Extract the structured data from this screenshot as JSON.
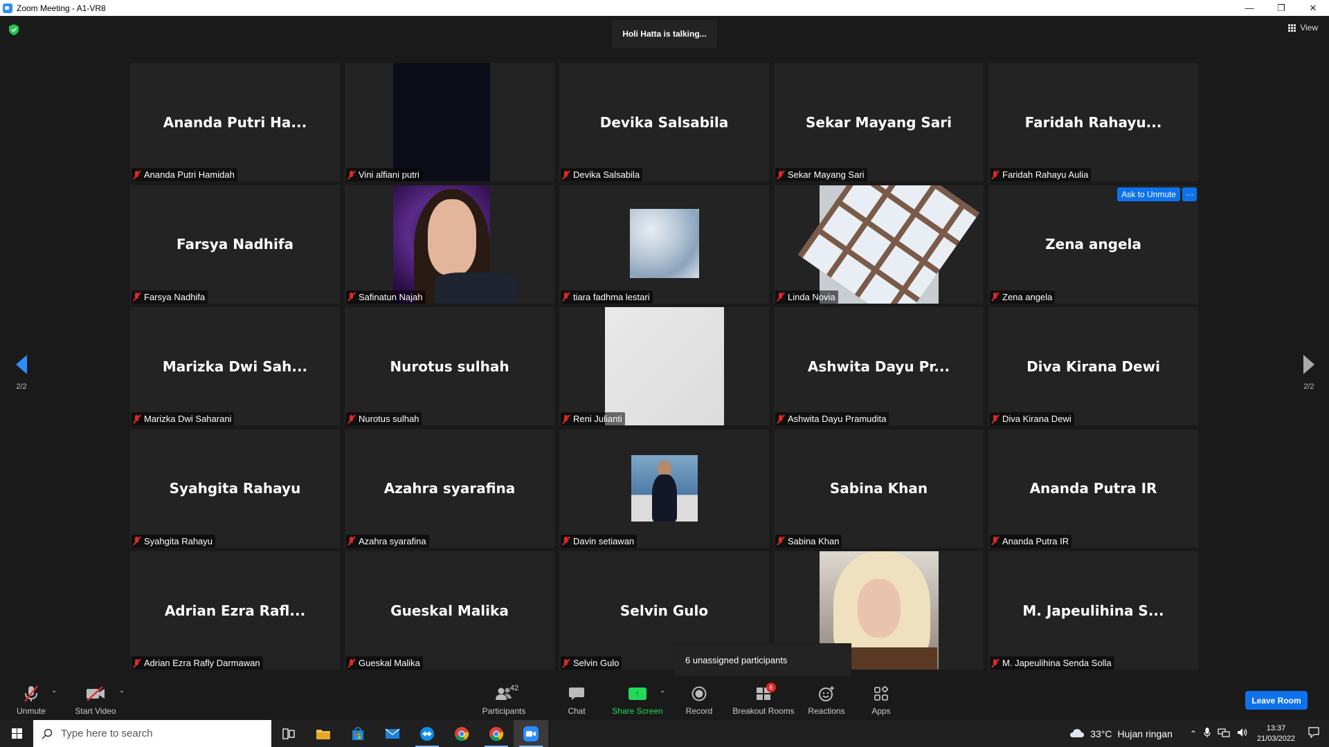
{
  "window": {
    "title": "Zoom Meeting - A1-VR8",
    "controls": [
      "—",
      "❐",
      "✕"
    ]
  },
  "meeting": {
    "talking_text": "Holi Hatta is talking...",
    "view_label": "View",
    "page_prev": "2/2",
    "page_next": "2/2",
    "unassigned_text": "6 unassigned participants",
    "ask_to_unmute": "Ask to Unmute",
    "more": "···"
  },
  "tiles": [
    {
      "big": "Ananda Putri Ha...",
      "name": "Ananda Putri Hamidah"
    },
    {
      "big": "",
      "name": "Vini alfiani putri",
      "video": "dark"
    },
    {
      "big": "Devika Salsabila",
      "name": "Devika Salsabila"
    },
    {
      "big": "Sekar Mayang Sari",
      "name": "Sekar Mayang Sari"
    },
    {
      "big": "Faridah  Rahayu...",
      "name": "Faridah Rahayu Aulia"
    },
    {
      "big": "Farsya Nadhifa",
      "name": "Farsya Nadhifa"
    },
    {
      "big": "",
      "name": "Safinatun Najah",
      "video": "portrait"
    },
    {
      "big": "",
      "name": "tiara fadhma lestari",
      "video": "sky"
    },
    {
      "big": "",
      "name": "Linda Novia",
      "video": "window"
    },
    {
      "big": "Zena angela",
      "name": "Zena angela"
    },
    {
      "big": "Marizka Dwi Sah...",
      "name": "Marizka Dwi Saharani"
    },
    {
      "big": "Nurotus sulhah",
      "name": "Nurotus sulhah"
    },
    {
      "big": "",
      "name": "Reni Julianti",
      "video": "white"
    },
    {
      "big": "Ashwita Dayu Pr...",
      "name": "Ashwita Dayu Pramudita"
    },
    {
      "big": "Diva Kirana Dewi",
      "name": "Diva Kirana Dewi"
    },
    {
      "big": "Syahgita Rahayu",
      "name": "Syahgita Rahayu"
    },
    {
      "big": "Azahra syarafina",
      "name": "Azahra syarafina"
    },
    {
      "big": "",
      "name": "Davin setiawan",
      "video": "man"
    },
    {
      "big": "Sabina Khan",
      "name": "Sabina Khan"
    },
    {
      "big": "Ananda Putra IR",
      "name": "Ananda Putra IR"
    },
    {
      "big": "Adrian Ezra Rafl...",
      "name": "Adrian Ezra Rafly Darmawan"
    },
    {
      "big": "Gueskal Malika",
      "name": "Gueskal Malika"
    },
    {
      "big": "Selvin Gulo",
      "name": "Selvin Gulo"
    },
    {
      "big": "",
      "name": "",
      "video": "girl"
    },
    {
      "big": "M. Japeulihina S...",
      "name": "M. Japeulihina Senda Solla"
    }
  ],
  "toolbar": {
    "unmute": "Unmute",
    "start_video": "Start Video",
    "participants": "Participants",
    "participants_count": "42",
    "chat": "Chat",
    "share_screen": "Share Screen",
    "record": "Record",
    "breakout_rooms": "Breakout Rooms",
    "breakout_badge": "6",
    "reactions": "Reactions",
    "apps": "Apps",
    "leave_room": "Leave Room",
    "accent_color": "#0e72ed",
    "share_color": "#23d959"
  },
  "taskbar": {
    "search_placeholder": "Type here to search",
    "weather_temp": "33°C",
    "weather_desc": "Hujan ringan",
    "time": "13:37",
    "date": "21/03/2022",
    "apps": [
      "task-view-icon",
      "file-explorer-icon",
      "store-icon",
      "mail-icon",
      "teamviewer-icon",
      "chrome-icon",
      "chrome-profile-icon",
      "zoom-icon"
    ]
  }
}
